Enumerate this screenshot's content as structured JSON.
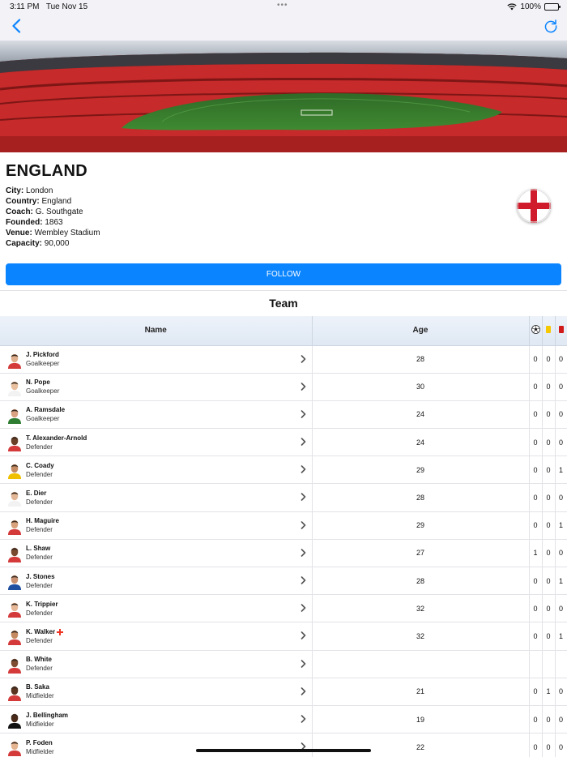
{
  "status": {
    "time": "3:11 PM",
    "date": "Tue Nov 15",
    "dots": "•••",
    "battery": "100%"
  },
  "team": {
    "name": "ENGLAND",
    "info": [
      {
        "label": "City:",
        "value": "London"
      },
      {
        "label": "Country:",
        "value": "England"
      },
      {
        "label": "Coach:",
        "value": "G. Southgate"
      },
      {
        "label": "Founded:",
        "value": "1863"
      },
      {
        "label": "Venue:",
        "value": "Wembley Stadium"
      },
      {
        "label": "Capacity:",
        "value": "90,000"
      }
    ],
    "follow_label": "FOLLOW",
    "section_title": "Team"
  },
  "table": {
    "headers": {
      "name": "Name",
      "age": "Age"
    },
    "rows": [
      {
        "name": "J. Pickford",
        "position": "Goalkeeper",
        "age": "28",
        "goals": "0",
        "yellow": "0",
        "red": "0",
        "injured": false
      },
      {
        "name": "N. Pope",
        "position": "Goalkeeper",
        "age": "30",
        "goals": "0",
        "yellow": "0",
        "red": "0",
        "injured": false
      },
      {
        "name": "A. Ramsdale",
        "position": "Goalkeeper",
        "age": "24",
        "goals": "0",
        "yellow": "0",
        "red": "0",
        "injured": false
      },
      {
        "name": "T. Alexander-Arnold",
        "position": "Defender",
        "age": "24",
        "goals": "0",
        "yellow": "0",
        "red": "0",
        "injured": false
      },
      {
        "name": "C. Coady",
        "position": "Defender",
        "age": "29",
        "goals": "0",
        "yellow": "0",
        "red": "1",
        "injured": false
      },
      {
        "name": "E. Dier",
        "position": "Defender",
        "age": "28",
        "goals": "0",
        "yellow": "0",
        "red": "0",
        "injured": false
      },
      {
        "name": "H. Maguire",
        "position": "Defender",
        "age": "29",
        "goals": "0",
        "yellow": "0",
        "red": "1",
        "injured": false
      },
      {
        "name": "L. Shaw",
        "position": "Defender",
        "age": "27",
        "goals": "1",
        "yellow": "0",
        "red": "0",
        "injured": false
      },
      {
        "name": "J. Stones",
        "position": "Defender",
        "age": "28",
        "goals": "0",
        "yellow": "0",
        "red": "1",
        "injured": false
      },
      {
        "name": "K. Trippier",
        "position": "Defender",
        "age": "32",
        "goals": "0",
        "yellow": "0",
        "red": "0",
        "injured": false
      },
      {
        "name": "K. Walker",
        "position": "Defender",
        "age": "32",
        "goals": "0",
        "yellow": "0",
        "red": "1",
        "injured": true
      },
      {
        "name": "B. White",
        "position": "Defender",
        "age": "",
        "goals": "",
        "yellow": "",
        "red": "",
        "injured": false
      },
      {
        "name": "B. Saka",
        "position": "Midfielder",
        "age": "21",
        "goals": "0",
        "yellow": "1",
        "red": "0",
        "injured": false
      },
      {
        "name": "J. Bellingham",
        "position": "Midfielder",
        "age": "19",
        "goals": "0",
        "yellow": "0",
        "red": "0",
        "injured": false
      },
      {
        "name": "P. Foden",
        "position": "Midfielder",
        "age": "22",
        "goals": "0",
        "yellow": "0",
        "red": "0",
        "injured": false
      }
    ]
  },
  "colors": {
    "accent": "#0a84ff",
    "header_bg": "#e6edf6",
    "jersey_red": "#cc2233",
    "skin": "#c98d6b"
  },
  "icons": {
    "back": "chevron-left-icon",
    "refresh": "refresh-icon",
    "goals": "soccer-ball-icon",
    "yellow": "yellow-card-icon",
    "red": "red-card-icon",
    "injury": "red-cross-icon"
  }
}
